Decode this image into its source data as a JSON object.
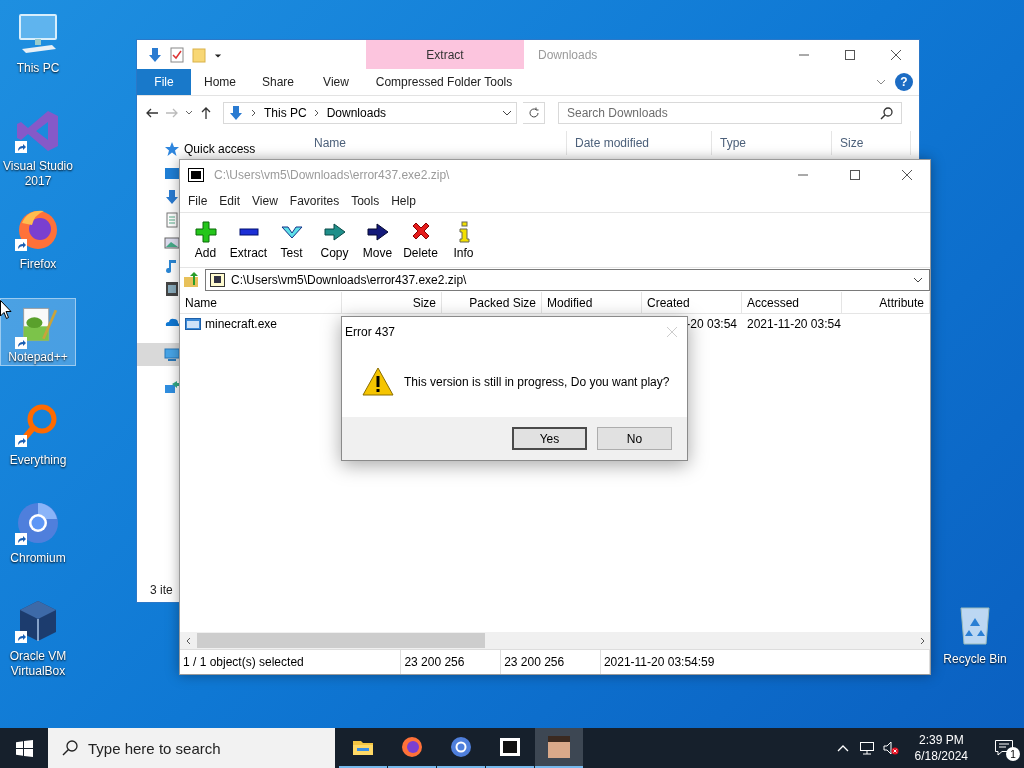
{
  "desktop_icons": [
    {
      "kind": "computer",
      "label": "This PC",
      "shortcut": false,
      "selected": false
    },
    {
      "kind": "visual-studio",
      "label": "Visual Studio 2017",
      "shortcut": true,
      "selected": false
    },
    {
      "kind": "firefox",
      "label": "Firefox",
      "shortcut": true,
      "selected": false
    },
    {
      "kind": "notepad",
      "label": "Notepad++",
      "shortcut": true,
      "selected": true
    },
    {
      "kind": "everything",
      "label": "Everything",
      "shortcut": true,
      "selected": false
    },
    {
      "kind": "chromium",
      "label": "Chromium",
      "shortcut": true,
      "selected": false
    },
    {
      "kind": "virtualbox",
      "label": "Oracle VM VirtualBox",
      "shortcut": true,
      "selected": false
    }
  ],
  "recycle_bin": {
    "label": "Recycle Bin"
  },
  "explorer": {
    "title": "Downloads",
    "context_tab": "Extract",
    "ribbon_tabs": [
      {
        "label": "File",
        "kind": "file"
      },
      {
        "label": "Home",
        "kind": "tab"
      },
      {
        "label": "Share",
        "kind": "tab"
      },
      {
        "label": "View",
        "kind": "tab"
      },
      {
        "label": "Compressed Folder Tools",
        "kind": "context"
      }
    ],
    "help": "?",
    "breadcrumb": [
      "This PC",
      "Downloads"
    ],
    "search": {
      "placeholder": "Search Downloads"
    },
    "columns": [
      "Name",
      "Date modified",
      "Type",
      "Size"
    ],
    "nav_items": [
      {
        "kind": "quick-access",
        "label": "Quick access",
        "selected": false
      },
      {
        "kind": "desktop",
        "selected": false
      },
      {
        "kind": "downloads",
        "selected": false
      },
      {
        "kind": "documents",
        "selected": false
      },
      {
        "kind": "pictures",
        "selected": false
      },
      {
        "kind": "music",
        "selected": false
      },
      {
        "kind": "videos",
        "selected": false
      },
      {
        "kind": "onedrive",
        "selected": false
      },
      {
        "kind": "this-pc",
        "selected": true
      },
      {
        "kind": "network",
        "selected": false
      }
    ],
    "status": "3 ite"
  },
  "archive_window": {
    "title": "C:\\Users\\vm5\\Downloads\\error437.exe2.zip\\",
    "menu": [
      "File",
      "Edit",
      "View",
      "Favorites",
      "Tools",
      "Help"
    ],
    "toolbar": [
      {
        "kind": "add",
        "label": "Add"
      },
      {
        "kind": "extract",
        "label": "Extract"
      },
      {
        "kind": "test",
        "label": "Test"
      },
      {
        "kind": "copy",
        "label": "Copy"
      },
      {
        "kind": "move",
        "label": "Move"
      },
      {
        "kind": "delete",
        "label": "Delete"
      },
      {
        "kind": "info",
        "label": "Info"
      }
    ],
    "address": "C:\\Users\\vm5\\Downloads\\error437.exe2.zip\\",
    "columns": [
      "Name",
      "Size",
      "Packed Size",
      "Modified",
      "Created",
      "Accessed",
      "Attribute"
    ],
    "rows": [
      {
        "name": "minecraft.exe",
        "created": "-20 03:54",
        "accessed": "2021-11-20 03:54"
      }
    ],
    "status_bar": [
      "1 / 1 object(s) selected",
      "23 200 256",
      "23 200 256",
      "2021-11-20 03:54:59"
    ]
  },
  "dialog": {
    "title": "Error 437",
    "message": "This version is still in progress, Do you want play?",
    "buttons": [
      {
        "label": "Yes",
        "default": true
      },
      {
        "label": "No",
        "default": false
      }
    ]
  },
  "taskbar": {
    "search_placeholder": "Type here to search",
    "apps": [
      {
        "kind": "file-explorer",
        "running": true,
        "selected": false
      },
      {
        "kind": "firefox",
        "running": true,
        "selected": false
      },
      {
        "kind": "chromium",
        "running": true,
        "selected": false
      },
      {
        "kind": "archiver",
        "running": true,
        "selected": false
      },
      {
        "kind": "game",
        "running": true,
        "selected": true
      }
    ],
    "time": "2:39 PM",
    "date": "6/18/2024",
    "notifications": "1"
  }
}
